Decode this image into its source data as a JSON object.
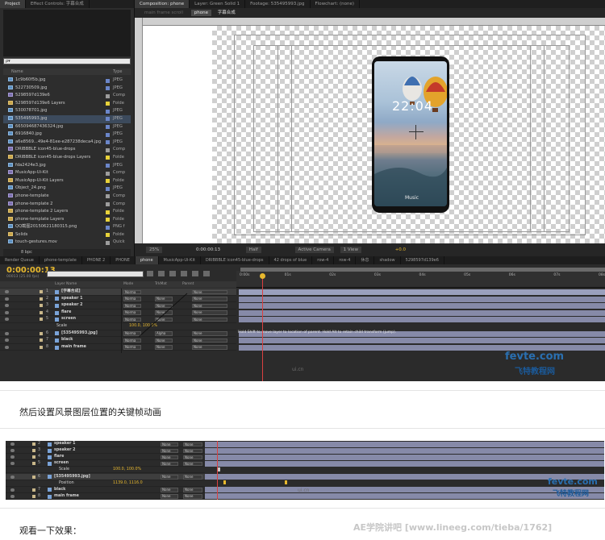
{
  "project_panel": {
    "tabs": [
      "Project",
      "Effect Controls: 字幕合成"
    ],
    "search_placeholder": "ρ▾",
    "col_name": "Name",
    "col_type": "Type",
    "items": [
      {
        "name": "1c9b60f5b.jpg",
        "type": "JPEG",
        "kind": "img",
        "color": "#6b86c9"
      },
      {
        "name": "522730509.jpg",
        "type": "JPEG",
        "kind": "img",
        "color": "#6b86c9"
      },
      {
        "name": "5298597d139e6",
        "type": "Comp",
        "kind": "comp",
        "color": "#9d9d9d"
      },
      {
        "name": "5298597d139e6 Layers",
        "type": "Folde",
        "kind": "folder",
        "color": "#e8d23a"
      },
      {
        "name": "530078701.jpg",
        "type": "JPEG",
        "kind": "img",
        "color": "#6b86c9"
      },
      {
        "name": "535495993.jpg",
        "type": "JPEG",
        "kind": "img",
        "color": "#6b86c9"
      },
      {
        "name": "665094687436324.jpg",
        "type": "JPEG",
        "kind": "img",
        "color": "#6b86c9"
      },
      {
        "name": "6916840.jpg",
        "type": "JPEG",
        "kind": "img",
        "color": "#6b86c9"
      },
      {
        "name": "a6e8569...49e4-81ee-e287238deca4.jpg",
        "type": "JPEG",
        "kind": "img",
        "color": "#6b86c9"
      },
      {
        "name": "DRIBBBLE icon45-blue-drops",
        "type": "Comp",
        "kind": "comp",
        "color": "#9d9d9d"
      },
      {
        "name": "DRIBBBLE icon45-blue-drops Layers",
        "type": "Folde",
        "kind": "folder",
        "color": "#e8d23a"
      },
      {
        "name": "fda2424e3.jpg",
        "type": "JPEG",
        "kind": "img",
        "color": "#6b86c9"
      },
      {
        "name": "MusicApp-Ui-Kit",
        "type": "Comp",
        "kind": "comp",
        "color": "#9d9d9d"
      },
      {
        "name": "MusicApp-Ui-Kit Layers",
        "type": "Folde",
        "kind": "folder",
        "color": "#e8d23a"
      },
      {
        "name": "Object_24.png",
        "type": "JPEG",
        "kind": "img",
        "color": "#6b86c9"
      },
      {
        "name": "phone-template",
        "type": "Comp",
        "kind": "comp",
        "color": "#9d9d9d"
      },
      {
        "name": "phone-template 2",
        "type": "Comp",
        "kind": "comp",
        "color": "#9d9d9d"
      },
      {
        "name": "phone-template 2 Layers",
        "type": "Folde",
        "kind": "folder",
        "color": "#e8d23a"
      },
      {
        "name": "phone-template Layers",
        "type": "Folde",
        "kind": "folder",
        "color": "#e8d23a"
      },
      {
        "name": "QQ截图20150621180315.png",
        "type": "PNG f",
        "kind": "img",
        "color": "#6b86c9"
      },
      {
        "name": "Solids",
        "type": "Folde",
        "kind": "folder",
        "color": "#e8d23a"
      },
      {
        "name": "touch-gestures.mov",
        "type": "Quick",
        "kind": "img",
        "color": "#9d9d9d"
      }
    ],
    "footer_bpc": "8 bpc"
  },
  "viewer": {
    "tabs": [
      "Composition: phone",
      "Layer: Green Solid 1",
      "Footage: 535495993.jpg",
      "Flowchart: (none)"
    ],
    "sub_tabs": [
      "main frame scroll",
      "phone",
      "字幕合成"
    ],
    "clock_text": "22:04",
    "music_label": "Music",
    "footer": {
      "zoom": "25%",
      "timecode": "0:00:00:13",
      "resolution": "Half",
      "camera": "Active Camera",
      "views": "1 View",
      "exposure": "+0.0"
    }
  },
  "timeline": {
    "tabs": [
      "Render Queue",
      "phone-template",
      "PHONE 2",
      "PHONE",
      "phone",
      "MusicApp-Ui-Kit",
      "DRIBBBLE icon45-blue-drops",
      "42 drops of blue",
      "row-4",
      "row-4",
      "休息",
      "shadow",
      "5298597d139e6"
    ],
    "timecode": "0:00:00:13",
    "fps": "00013 (25.00 fps)",
    "col_headers": {
      "layer_name": "Layer Name",
      "mode": "Mode",
      "trkmat": "TrkMat",
      "parent": "Parent"
    },
    "ruler_ticks": [
      "0:00s",
      "01s",
      "02s",
      "03s",
      "04s",
      "05s",
      "06s",
      "07s",
      "08s"
    ],
    "layers": [
      {
        "num": "1",
        "name": "[字幕合成]",
        "mode": "Norma",
        "trk": "",
        "parent": "None",
        "color": "#c9b78a"
      },
      {
        "num": "2",
        "name": "speaker 1",
        "mode": "Norma",
        "trk": "None",
        "parent": "None",
        "color": "#c9b78a"
      },
      {
        "num": "3",
        "name": "speaker 2",
        "mode": "Norma",
        "trk": "None",
        "parent": "None",
        "color": "#c9b78a"
      },
      {
        "num": "4",
        "name": "flare",
        "mode": "Norma",
        "trk": "None",
        "parent": "None",
        "color": "#c9b78a"
      },
      {
        "num": "5",
        "name": "screen",
        "mode": "Norma",
        "trk": "None",
        "parent": "None",
        "color": "#c9b78a"
      },
      {
        "num": "",
        "name": "Scale",
        "mode": "",
        "trk": "",
        "parent": "",
        "value": "100.0, 100.0%"
      },
      {
        "num": "6",
        "name": "[535495993.jpg]",
        "mode": "Norma",
        "trk": "Alpha",
        "parent": "None",
        "color": "#c9b78a"
      },
      {
        "num": "7",
        "name": "black",
        "mode": "Norma",
        "trk": "None",
        "parent": "None",
        "color": "#c9b78a"
      },
      {
        "num": "8",
        "name": "main frame",
        "mode": "Norma",
        "trk": "None",
        "parent": "None",
        "color": "#c9b78a"
      }
    ],
    "hint": "Hold Shift to move layer to location of parent. Hold Alt to retain child transform (jump)."
  },
  "caption_1": "然后设置风景图层位置的关键帧动画",
  "caption_2": "观看一下效果：",
  "shot2": {
    "layers": [
      {
        "num": "2",
        "name": "speaker 1"
      },
      {
        "num": "3",
        "name": "speaker 2"
      },
      {
        "num": "4",
        "name": "flare"
      },
      {
        "num": "5",
        "name": "screen"
      },
      {
        "num": "",
        "name": "Scale",
        "value": "100.0, 100.0%"
      },
      {
        "num": "6",
        "name": "[535495993.jpg]"
      },
      {
        "num": "",
        "name": "Position",
        "value": "1139.0, 1116.0"
      },
      {
        "num": "7",
        "name": "black"
      },
      {
        "num": "8",
        "name": "main frame"
      }
    ],
    "mode": "Norma",
    "trk": "None",
    "parent": "None"
  },
  "watermarks": {
    "site1": "fevte.com",
    "site1_cn": "飞特教程网",
    "uicn": "ui.cn",
    "footer_text": "AE学院讲吧  [www.lineeg.com/tieba/1762]"
  },
  "colors": {
    "accent_time": "#e7b82e",
    "cti": "#d94040",
    "bar": "#868aa8"
  }
}
